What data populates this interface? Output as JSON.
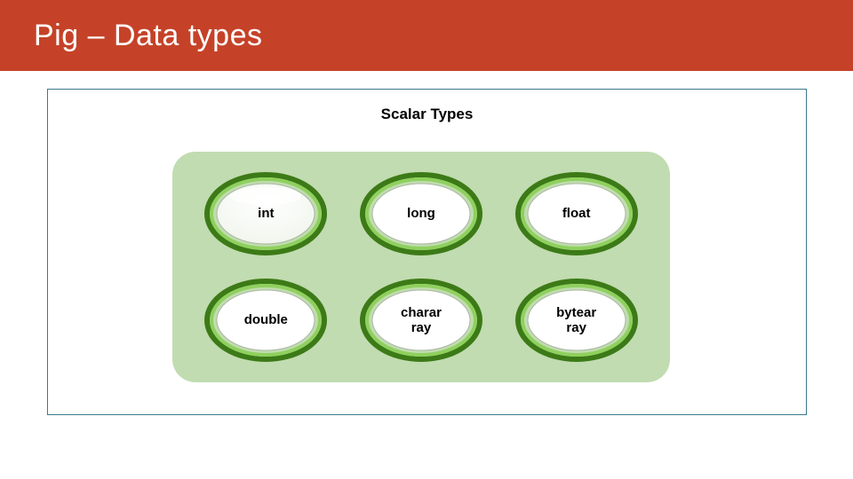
{
  "slide": {
    "title": "Pig – Data types",
    "diagram_title": "Scalar Types",
    "items": [
      {
        "label": "int"
      },
      {
        "label": "long"
      },
      {
        "label": "float"
      },
      {
        "label": "double"
      },
      {
        "label": "charar\nray"
      },
      {
        "label": "bytear\nray"
      }
    ],
    "colors": {
      "title_bar": "#c54228",
      "box": "#c1dcb0",
      "ring_outer": "#3c7a17",
      "ring_inner": "#7bbf45"
    }
  }
}
